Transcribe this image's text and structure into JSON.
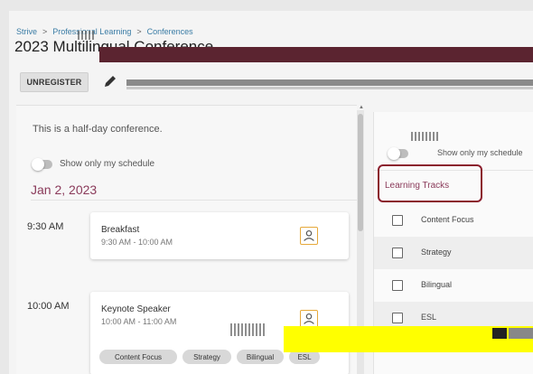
{
  "breadcrumb": {
    "items": [
      "Strive",
      "Professional Learning",
      "Conferences"
    ],
    "separator": ">"
  },
  "page": {
    "title": "2023 Multilingual Conference"
  },
  "toolbar": {
    "unregister_label": "UNREGISTER",
    "edit_icon": "pencil-icon"
  },
  "left": {
    "intro": "This is a half-day conference.",
    "toggle_label": "Show only my schedule",
    "date": "Jan 2, 2023",
    "sessions": [
      {
        "time": "9:30 AM",
        "name": "Breakfast",
        "range": "9:30 AM - 10:00 AM"
      },
      {
        "time": "10:00 AM",
        "name": "Keynote Speaker",
        "range": "10:00 AM - 11:00 AM",
        "tags": [
          "Content Focus",
          "Strategy",
          "Bilingual",
          "ESL"
        ]
      }
    ]
  },
  "right": {
    "toggle_label": "Show only my schedule",
    "section_title": "Learning Tracks",
    "tracks": [
      "Content Focus",
      "Strategy",
      "Bilingual",
      "ESL"
    ]
  },
  "colors": {
    "accent": "#8a3a5a",
    "highlight_box": "#8b1e2d",
    "icon": "#e6a93b",
    "link": "#3a7ca5"
  }
}
